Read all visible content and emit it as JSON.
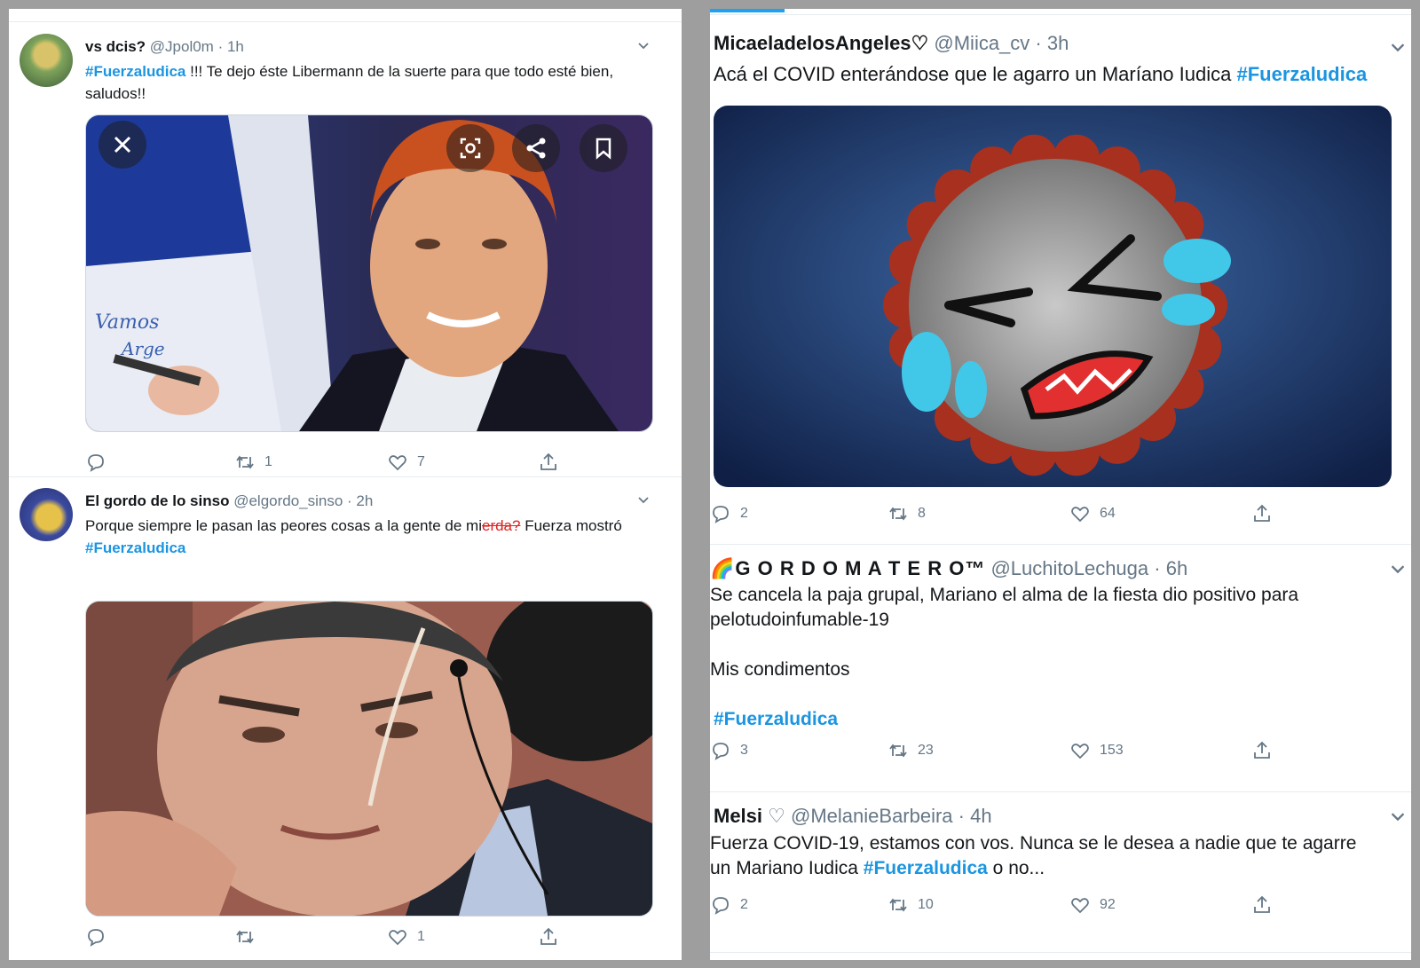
{
  "left": {
    "tweets": [
      {
        "name": "vs dcis?",
        "handle": "@Jpol0m",
        "time": "· 1h",
        "hashtag": "#Fuerzaludica",
        "text": " !!! Te dejo éste Libermann de la suerte para que todo esté bien, saludos!!",
        "replies": "",
        "retweets": "1",
        "likes": "7",
        "image_text_1": "Vamos",
        "image_text_2": "Arge"
      },
      {
        "name": "El gordo de lo sinso",
        "handle": "@elgordo_sinso",
        "time": "· 2h",
        "text_part1": "Porque siempre le pasan las peores cosas a la gente de mi",
        "text_scribble": "erda?",
        "text_part2": "  Fuerza mostró",
        "hashtag": "#Fuerzaludica",
        "replies": "",
        "retweets": "",
        "likes": "1"
      }
    ]
  },
  "right": {
    "tweets": [
      {
        "name": "MicaeladelosAngeles♡",
        "handle": "@Miica_cv",
        "time": "· 3h",
        "text": "Acá el COVID enterándose que le agarro un Maríano Iudica ",
        "hashtag": "#Fuerzaludica",
        "replies": "2",
        "retweets": "8",
        "likes": "64"
      },
      {
        "name": "🌈G O R D O M A T E R O™",
        "handle": "@LuchitoLechuga",
        "time": "· 6h",
        "line1": "Se cancela la paja grupal, Mariano el alma de la fiesta dio positivo para",
        "line2": "pelotudoinfumable-19",
        "line3": "Mis condimentos",
        "hashtag": "#Fuerzaludica",
        "replies": "3",
        "retweets": "23",
        "likes": "153"
      },
      {
        "name": "Melsi",
        "name_symbol": "♡",
        "handle": "@MelanieBarbeira",
        "time": "· 4h",
        "line1": "Fuerza COVID-19, estamos con vos. Nunca se le desea a nadie que te agarre",
        "line2_pre": "un Mariano Iudica ",
        "hashtag": "#Fuerzaludica",
        "line2_post": " o no...",
        "replies": "2",
        "retweets": "10",
        "likes": "92"
      }
    ]
  },
  "colors": {
    "link": "#1b95e0",
    "meta": "#657786",
    "text": "#14171a",
    "background": "#9e9e9e"
  },
  "icons": [
    "reply-icon",
    "retweet-icon",
    "like-icon",
    "share-icon",
    "chevron-down-icon",
    "close-icon",
    "lens-icon",
    "bookmark-icon"
  ]
}
